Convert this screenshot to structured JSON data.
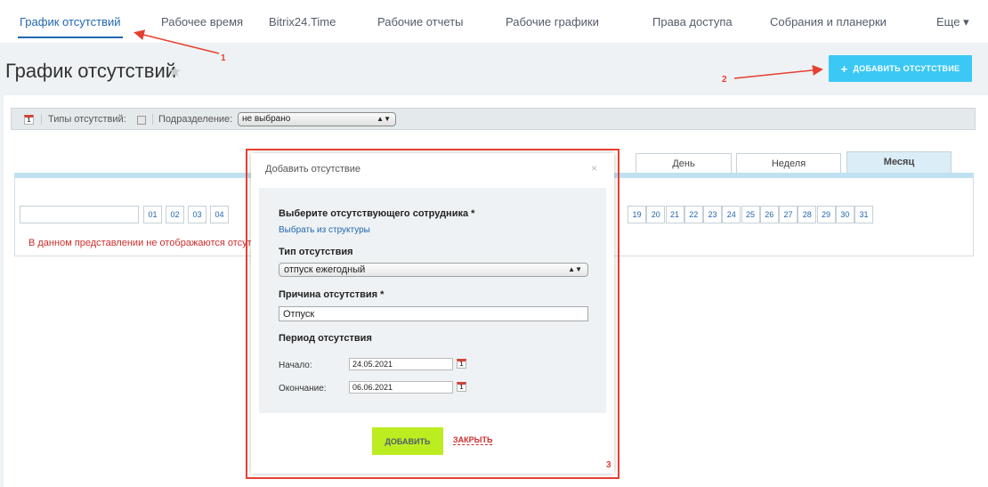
{
  "nav": {
    "tabs": [
      {
        "label": "График отсутствий",
        "active": true
      },
      {
        "label": "Рабочее время"
      },
      {
        "label": "Bitrix24.Time"
      },
      {
        "label": "Рабочие отчеты"
      },
      {
        "label": "Рабочие графики"
      },
      {
        "label": "Права доступа"
      },
      {
        "label": "Собрания и планерки"
      },
      {
        "label": "Еще ▾"
      }
    ]
  },
  "page": {
    "title": "График отсутствий",
    "add_button": "ДОБАВИТЬ ОТСУТСТВИЕ",
    "accent_color": "#3bc8f5",
    "link_color": "#2067b0"
  },
  "filter": {
    "calendar_icon_label": "1",
    "types_label": "Типы отсутствий:",
    "department_label": "Подразделение:",
    "department_value": "не выбрано"
  },
  "view_tabs": [
    {
      "label": "День"
    },
    {
      "label": "Неделя"
    },
    {
      "label": "Месяц",
      "active": true
    }
  ],
  "calendar": {
    "days": [
      "01",
      "02",
      "03",
      "04",
      "19",
      "20",
      "21",
      "22",
      "23",
      "24",
      "25",
      "26",
      "27",
      "28",
      "29",
      "30",
      "31"
    ],
    "note": "В данном представлении не отображаются отсутстви"
  },
  "modal": {
    "title": "Добавить отсутствие",
    "close": "×",
    "employee_label": "Выберите отсутствующего сотрудника *",
    "employee_link": "Выбрать из структуры",
    "type_label": "Тип отсутствия",
    "type_value": "отпуск ежегодный",
    "reason_label": "Причина отсутствия *",
    "reason_value": "Отпуск",
    "period_label": "Период отсутствия",
    "start_label": "Начало:",
    "start_value": "24.05.2021",
    "end_label": "Окончание:",
    "end_value": "06.06.2021",
    "submit": "ДОБАВИТЬ",
    "cancel": "ЗАКРЫТЬ",
    "submit_color": "#bbed21"
  },
  "annotations": {
    "color": "#e64032",
    "labels": [
      "1",
      "2",
      "3"
    ]
  }
}
